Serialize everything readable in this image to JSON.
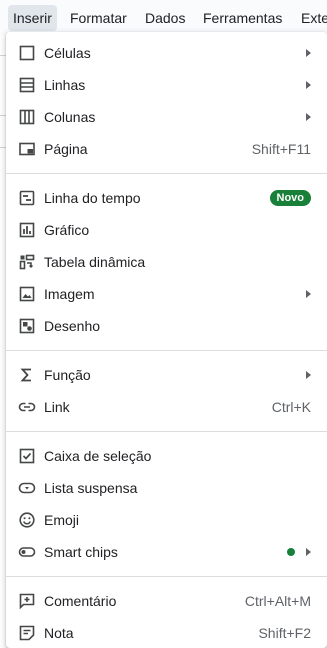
{
  "menubar": {
    "items": [
      "Inserir",
      "Formatar",
      "Dados",
      "Ferramentas",
      "Exte"
    ]
  },
  "menu": {
    "celulas": {
      "label": "Células"
    },
    "linhas": {
      "label": "Linhas"
    },
    "colunas": {
      "label": "Colunas"
    },
    "pagina": {
      "label": "Página",
      "shortcut": "Shift+F11"
    },
    "linha_do_tempo": {
      "label": "Linha do tempo",
      "badge": "Novo"
    },
    "grafico": {
      "label": "Gráfico"
    },
    "tabela_dinamica": {
      "label": "Tabela dinâmica"
    },
    "imagem": {
      "label": "Imagem"
    },
    "desenho": {
      "label": "Desenho"
    },
    "funcao": {
      "label": "Função"
    },
    "link": {
      "label": "Link",
      "shortcut": "Ctrl+K"
    },
    "caixa_selecao": {
      "label": "Caixa de seleção"
    },
    "lista_suspensa": {
      "label": "Lista suspensa"
    },
    "emoji": {
      "label": "Emoji"
    },
    "smart_chips": {
      "label": "Smart chips"
    },
    "comentario": {
      "label": "Comentário",
      "shortcut": "Ctrl+Alt+M"
    },
    "nota": {
      "label": "Nota",
      "shortcut": "Shift+F2"
    }
  },
  "icons": {
    "celulas": "square-icon",
    "linhas": "rows-icon",
    "colunas": "columns-icon",
    "pagina": "page-icon",
    "linha_do_tempo": "timeline-icon",
    "grafico": "chart-icon",
    "tabela_dinamica": "pivot-table-icon",
    "imagem": "image-icon",
    "desenho": "drawing-icon",
    "funcao": "sigma-icon",
    "link": "link-icon",
    "caixa_selecao": "checkbox-icon",
    "lista_suspensa": "dropdown-icon",
    "emoji": "emoji-icon",
    "smart_chips": "smart-chips-icon",
    "comentario": "add-comment-icon",
    "nota": "note-icon"
  },
  "colors": {
    "accent_green": "#188038",
    "menubar_active": "#e1e6ed",
    "icon": "#444746"
  }
}
